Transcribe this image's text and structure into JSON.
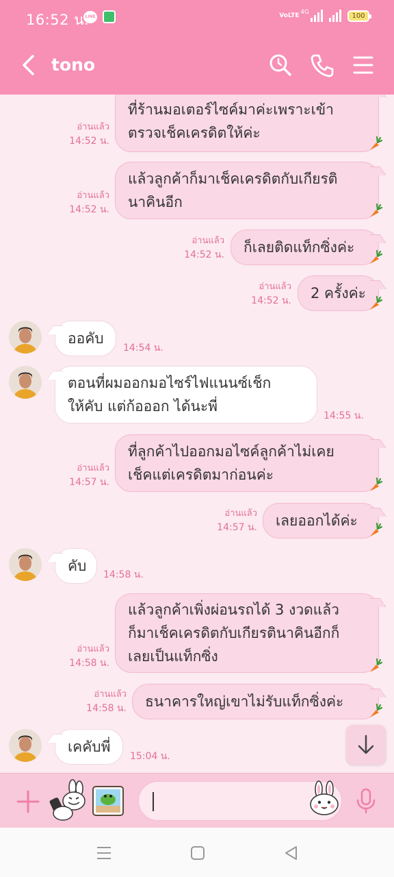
{
  "status_bar": {
    "time": "16:52 น.",
    "line_icon_text": "LINE",
    "volte_text": "VoLTE",
    "network_text": "4G",
    "battery_level": "100"
  },
  "header": {
    "contact_name": "tono"
  },
  "read_label": "อ่านแล้ว",
  "messages": [
    {
      "lines": [
        "ที่ร้านมอเตอร์ไซค์มาค่ะเพราะเข้า",
        "ตรวจเช็คเครดิตให้ค่ะ"
      ],
      "time": "14:52 น."
    },
    {
      "lines": [
        "แล้วลูกค้าก็มาเช็คเครดิตกับเกียรติ",
        "นาคินอีก"
      ],
      "time": "14:52 น."
    },
    {
      "lines": [
        "ก็เลยติดแท็กซิ่งค่ะ"
      ],
      "time": "14:52 น."
    },
    {
      "lines": [
        "2 ครั้งค่ะ"
      ],
      "time": "14:52 น."
    },
    {
      "lines": [
        "ออคับ"
      ],
      "time": "14:54 น."
    },
    {
      "lines": [
        "ตอนที่ผมออกมอไซร์ไฟแนนซ์เช็ก",
        "ให้คับ แต่ก้อออก ได้นะพี่"
      ],
      "time": "14:55 น."
    },
    {
      "lines": [
        "ที่ลูกค้าไปออกมอไซค์ลูกค้าไม่เคย",
        "เช็คแต่เครดิตมาก่อนค่ะ"
      ],
      "time": "14:57 น."
    },
    {
      "lines": [
        "เลยออกได้ค่ะ"
      ],
      "time": "14:57 น."
    },
    {
      "lines": [
        "คับ"
      ],
      "time": "14:58 น."
    },
    {
      "lines": [
        "แล้วลูกค้าเพิ่งผ่อนรถได้ 3 งวดแล้ว",
        "ก็มาเช็คเครดิตกับเกียรตินาคินอีกก็",
        "เลยเป็นแท็กซิ่ง"
      ],
      "time": "14:58 น."
    },
    {
      "lines": [
        "ธนาคารใหญ่เขาไม่รับแท็กซิ่งค่ะ"
      ],
      "time": "14:58 น."
    },
    {
      "lines": [
        "เคคับพี่"
      ],
      "time": "15:04 น."
    }
  ]
}
